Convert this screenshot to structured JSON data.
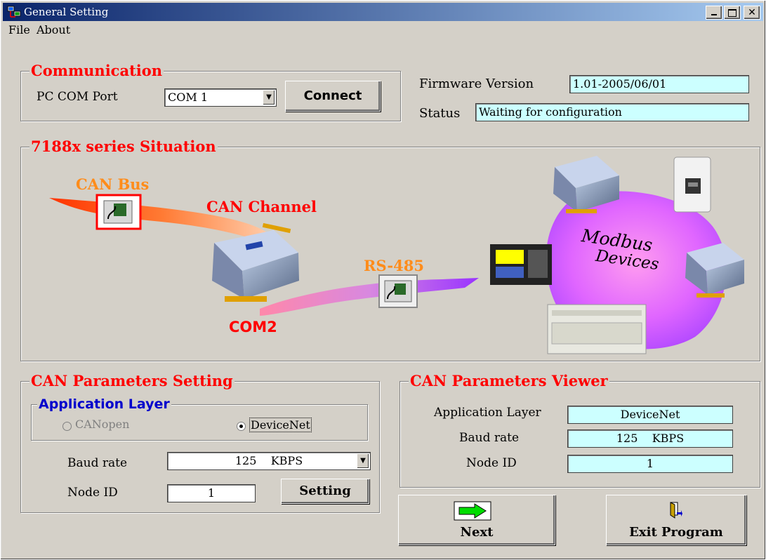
{
  "window": {
    "title": "General Setting"
  },
  "menu": {
    "items": [
      "File",
      "About"
    ]
  },
  "communication": {
    "legend": "Communication",
    "com_port_label": "PC COM Port",
    "com_port_value": "COM 1",
    "connect_label": "Connect"
  },
  "firmware": {
    "version_label": "Firmware Version",
    "version_value": "1.01-2005/06/01",
    "status_label": "Status",
    "status_value": "Waiting for configuration"
  },
  "situation": {
    "legend": "7188x series Situation",
    "can_bus_label": "CAN Bus",
    "can_channel_label": "CAN Channel",
    "rs485_label": "RS-485",
    "com2_label": "COM2",
    "modbus_label_1": "Modbus",
    "modbus_label_2": "Devices"
  },
  "can_setting": {
    "legend": "CAN Parameters Setting",
    "app_layer_legend": "Application Layer",
    "option_canopen": "CANopen",
    "option_devicenet": "DeviceNet",
    "selected_option": "DeviceNet",
    "baud_label": "Baud rate",
    "baud_value": "125    KBPS",
    "node_label": "Node ID",
    "node_value": "1",
    "setting_button": "Setting"
  },
  "can_viewer": {
    "legend": "CAN Parameters Viewer",
    "app_layer_label": "Application Layer",
    "app_layer_value": "DeviceNet",
    "baud_label": "Baud rate",
    "baud_value": "125    KBPS",
    "node_label": "Node ID",
    "node_value": "1"
  },
  "actions": {
    "next_label": "Next",
    "exit_label": "Exit Program"
  },
  "colors": {
    "title_bar": "#0a246a",
    "legend_red": "#ff0000",
    "field_cyan": "#ccffff",
    "can_bus_orange": "#ff8c1a",
    "app_layer_blue": "#0000cc"
  }
}
